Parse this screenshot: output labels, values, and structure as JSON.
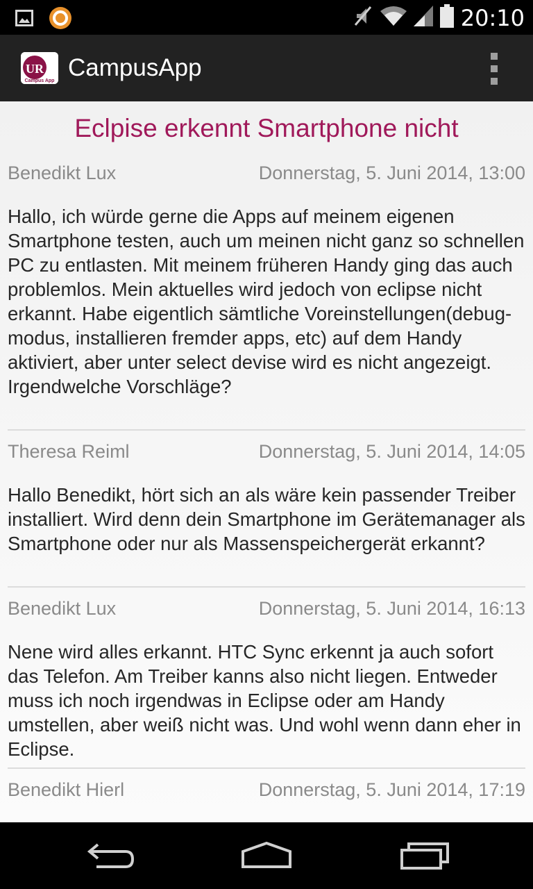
{
  "status_bar": {
    "time": "20:10",
    "icons": [
      "image-notification-icon",
      "app-notification-icon",
      "mute-icon",
      "wifi-icon",
      "signal-icon",
      "battery-icon"
    ]
  },
  "action_bar": {
    "logo_text": "UR",
    "logo_subtext": "Campus App",
    "title": "CampusApp",
    "overflow_icon": "overflow-menu-icon"
  },
  "thread": {
    "title": "Eclpise erkennt Smartphone nicht",
    "posts": [
      {
        "author": "Benedikt Lux",
        "date": "Donnerstag, 5. Juni 2014, 13:00",
        "body": "Hallo, ich würde gerne die Apps auf meinem eigenen Smartphone testen, auch um meinen nicht ganz so schnellen PC zu entlasten. Mit meinem früheren Handy ging das auch problemlos. Mein aktuelles wird jedoch von eclipse nicht erkannt. Habe eigentlich sämtliche Voreinstellungen(debug-modus, installieren fremder apps, etc) auf dem Handy aktiviert, aber unter select devise wird es nicht angezeigt. Irgendwelche Vorschläge?"
      },
      {
        "author": "Theresa Reiml",
        "date": "Donnerstag, 5. Juni 2014, 14:05",
        "body": "Hallo Benedikt, hört sich an als wäre kein passender Treiber installiert. Wird denn dein Smartphone im Gerätemanager als Smartphone oder nur als Massenspeichergerät erkannt?"
      },
      {
        "author": "Benedikt Lux",
        "date": "Donnerstag, 5. Juni 2014, 16:13",
        "body": "Nene wird alles erkannt. HTC Sync erkennt ja auch sofort das Telefon. Am Treiber kanns also nicht liegen. Entweder muss ich noch irgendwas in Eclipse oder am Handy umstellen, aber weiß nicht was. Und wohl wenn dann eher in Eclipse."
      },
      {
        "author": "Benedikt Hierl",
        "date": "Donnerstag, 5. Juni 2014, 17:19",
        "body": ""
      }
    ]
  },
  "colors": {
    "accent": "#a0195a",
    "action_bar": "#222222",
    "meta_text": "#8a8a8a",
    "body_text": "#262626"
  },
  "nav_bar": {
    "buttons": [
      "back-icon",
      "home-icon",
      "recent-apps-icon"
    ]
  }
}
